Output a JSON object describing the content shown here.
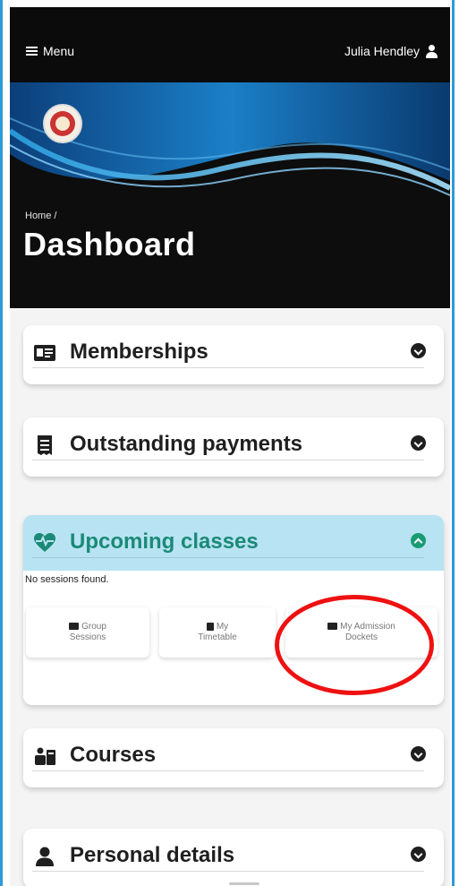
{
  "header": {
    "menu_label": "Menu",
    "user_name": "Julia Hendley"
  },
  "banner": {
    "breadcrumb": "Home  /",
    "page_title": "Dashboard"
  },
  "panels": {
    "memberships": {
      "title": "Memberships",
      "icon": "id-card-icon",
      "state": "collapsed"
    },
    "outstanding": {
      "title": "Outstanding payments",
      "icon": "receipt-icon",
      "state": "collapsed"
    },
    "upcoming": {
      "title": "Upcoming classes",
      "icon": "heartbeat-icon",
      "state": "expanded",
      "empty_text": "No sessions found.",
      "shortcuts": [
        {
          "line1": "Group",
          "line2": "Sessions",
          "icon": "group-icon"
        },
        {
          "line1": "My",
          "line2": "Timetable",
          "icon": "calendar-icon"
        },
        {
          "line1": "My Admission",
          "line2": "Dockets",
          "icon": "ticket-icon"
        }
      ]
    },
    "courses": {
      "title": "Courses",
      "icon": "courses-icon",
      "state": "collapsed"
    },
    "personal": {
      "title": "Personal details",
      "icon": "user-icon",
      "state": "collapsed"
    }
  },
  "colors": {
    "accent_green": "#1a9b72",
    "expanded_header_bg": "#b8e3f3",
    "annotation_red": "#ee1111"
  }
}
